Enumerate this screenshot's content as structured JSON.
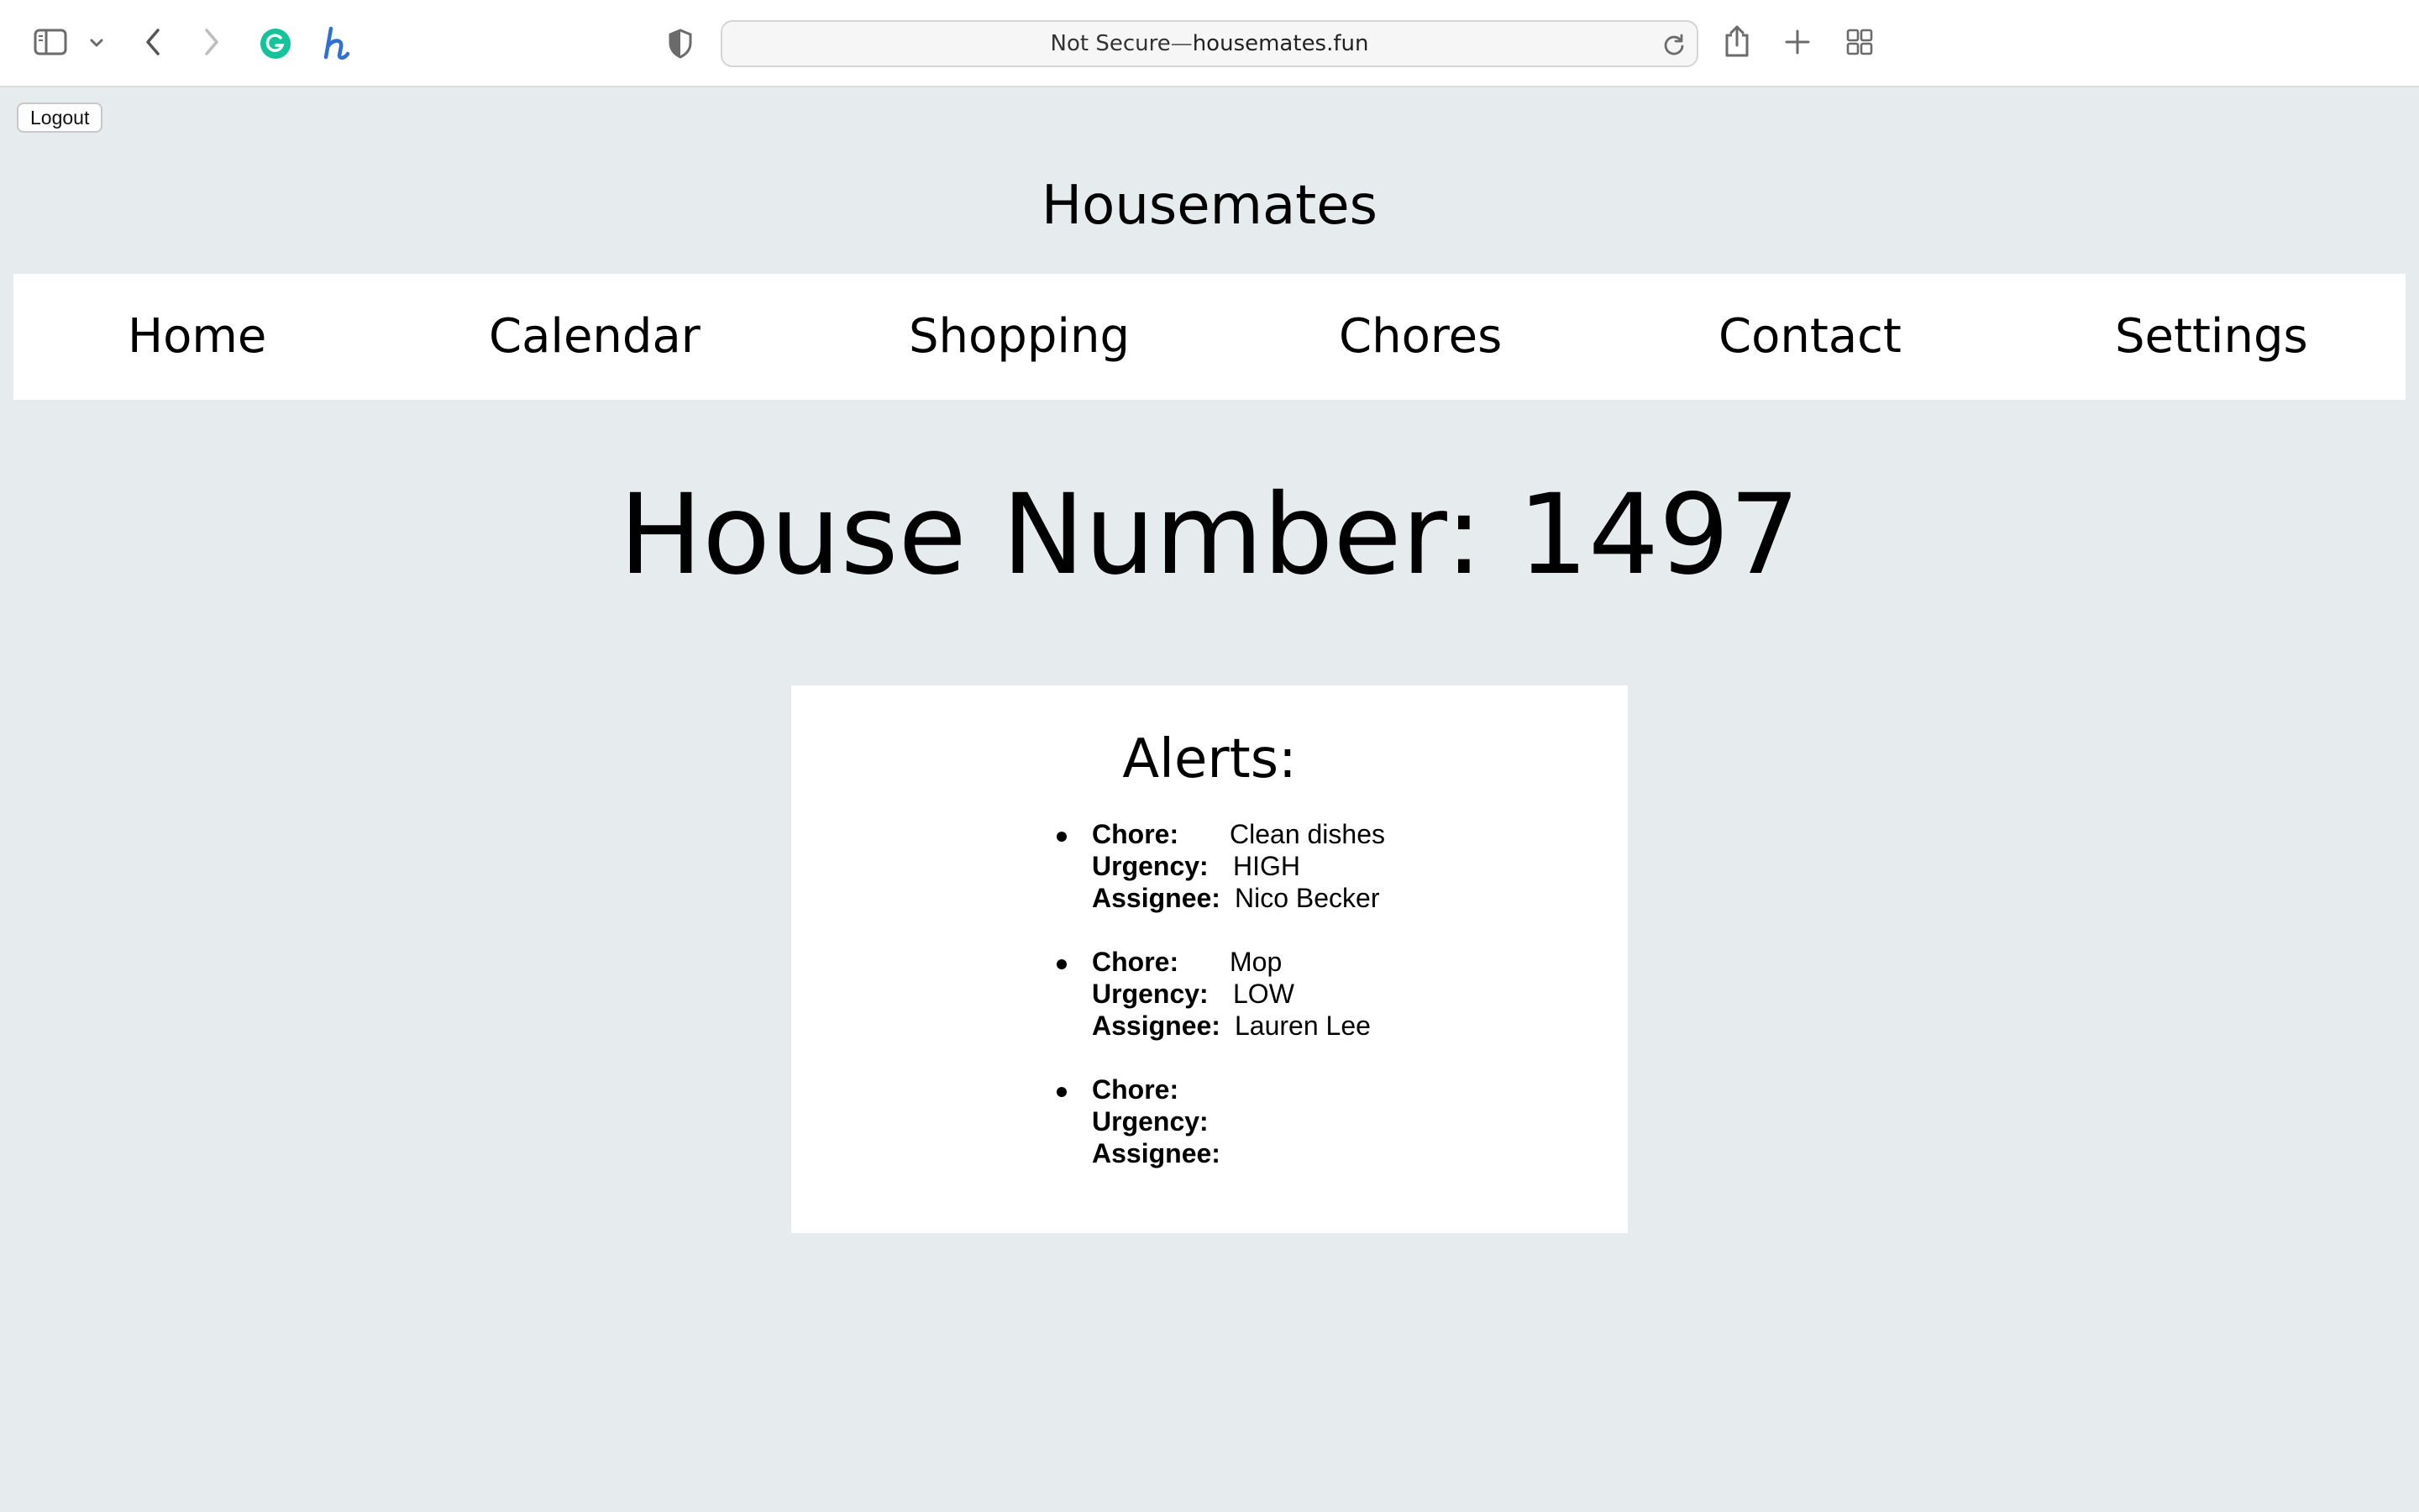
{
  "browser": {
    "url_prefix": "Not Secure",
    "url_separator": " — ",
    "url_domain": "housemates.fun",
    "icons": [
      "sidebar-icon",
      "chevron-down-icon",
      "back-icon",
      "forward-icon",
      "grammarly-icon",
      "honey-icon",
      "privacy-shield-icon",
      "reload-icon",
      "share-icon",
      "new-tab-icon",
      "tab-overview-icon"
    ]
  },
  "page": {
    "logout_label": "Logout",
    "site_title": "Housemates",
    "nav": {
      "home": "Home",
      "calendar": "Calendar",
      "shopping": "Shopping",
      "chores": "Chores",
      "contact": "Contact",
      "settings": "Settings"
    },
    "house_number": "House Number: 1497",
    "alerts": {
      "title": "Alerts:",
      "labels": {
        "chore": "Chore:",
        "urgency": "Urgency:",
        "assignee": "Assignee:"
      },
      "items": [
        {
          "chore": "Clean dishes",
          "urgency": "HIGH",
          "assignee": "Nico Becker"
        },
        {
          "chore": "Mop",
          "urgency": "LOW",
          "assignee": "Lauren Lee"
        },
        {
          "chore": "",
          "urgency": "",
          "assignee": ""
        }
      ]
    }
  },
  "colors": {
    "page_background": "#e6ebee",
    "panel_background": "#ffffff",
    "grammarly_green": "#15c39a",
    "honey_blue": "#2f6fd6"
  }
}
